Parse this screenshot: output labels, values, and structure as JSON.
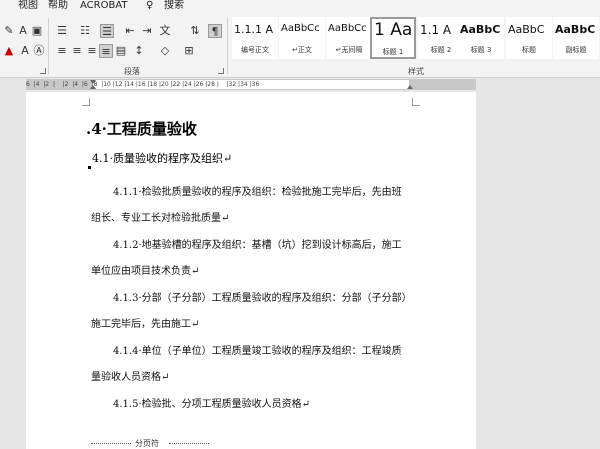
{
  "menu": {
    "items": [
      "视图",
      "帮助",
      "ACROBAT"
    ],
    "search_label": "搜索"
  },
  "ribbon": {
    "paragraph_group_label": "段落",
    "styles_group_label": "样式",
    "styles": [
      {
        "preview": "1.1.1 A",
        "name": "编号正文"
      },
      {
        "preview": "AaBbCc",
        "name": "↵正文"
      },
      {
        "preview": "AaBbCc",
        "name": "↵无间隔"
      },
      {
        "preview": "1 Aa",
        "name": "标题 1"
      },
      {
        "preview": "1.1 A",
        "name": "标题 2"
      },
      {
        "preview": "AaBbC",
        "name": "标题 3"
      },
      {
        "preview": "AaBbC",
        "name": "标题"
      },
      {
        "preview": "AaBbC",
        "name": "副标题"
      }
    ]
  },
  "ruler": {
    "text": "6  |4  |2  |    |2  |4  |6  |8  |10 |12 |14 |16 |18 |20 |22 |24 |26 |28 |    |32 |34 |36"
  },
  "document": {
    "h1": ".4·工程质量验收",
    "h2": "4.1·质量验收的程序及组织↵",
    "paragraphs": [
      "4.1.1·检验批质量验收的程序及组织：检验批施工完毕后，先由班组长、专业工长对检验批质量↵",
      "4.1.2·地基验槽的程序及组织：基槽（坑）挖到设计标高后，施工单位应由项目技术负责↵",
      "4.1.3·分部（子分部）工程质量验收的程序及组织：分部（子分部）施工完毕后，先由施工↵",
      "4.1.4·单位（子单位）工程质量竣工验收的程序及组织：工程竣质量验收人员资格↵",
      "4.1.5·检验批、分项工程质量验收人员资格↵"
    ],
    "page_break_label": "分页符"
  }
}
